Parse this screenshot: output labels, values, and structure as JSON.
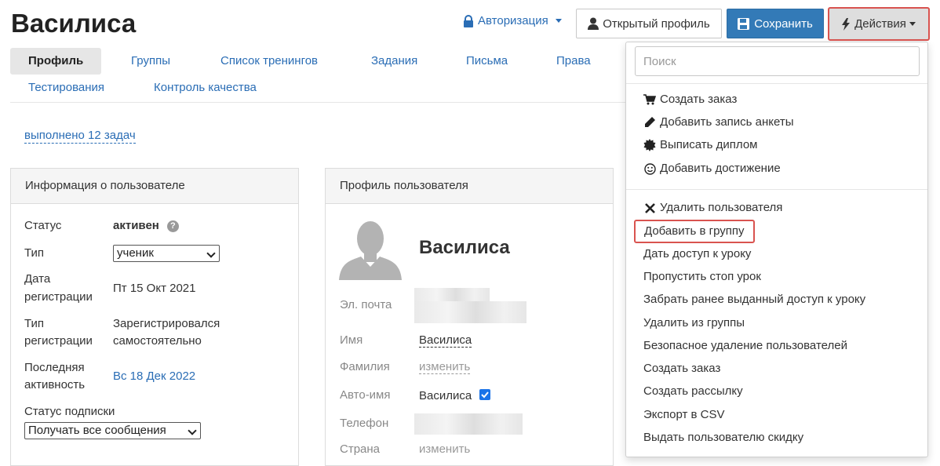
{
  "header": {
    "title": "Василиса",
    "auth_label": "Авторизация",
    "open_profile_label": "Открытый профиль",
    "save_label": "Сохранить",
    "actions_label": "Действия"
  },
  "tabs": [
    "Профиль",
    "Группы",
    "Список тренингов",
    "Задания",
    "Письма",
    "Права",
    "Тестирования",
    "Контроль качества"
  ],
  "tasks_link": "выполнено 12 задач",
  "user_info": {
    "heading": "Информация о пользователе",
    "status_label": "Статус",
    "status_value": "активен",
    "type_label": "Тип",
    "type_value": "ученик",
    "reg_date_label_1": "Дата",
    "reg_date_label_2": "регистрации",
    "reg_date_value": "Пт 15 Окт 2021",
    "reg_type_label_1": "Тип",
    "reg_type_label_2": "регистрации",
    "reg_type_value_1": "Зарегистрировался",
    "reg_type_value_2": "самостоятельно",
    "last_activity_label_1": "Последняя",
    "last_activity_label_2": "активность",
    "last_activity_value": "Вс 18 Дек 2022",
    "subscription_label": "Статус подписки",
    "subscription_value": "Получать все сообщения"
  },
  "profile": {
    "heading": "Профиль пользователя",
    "name_big": "Василиса",
    "email_label": "Эл. почта",
    "first_name_label": "Имя",
    "first_name_value": "Василиса",
    "last_name_label": "Фамилия",
    "last_name_value": "изменить",
    "auto_name_label": "Авто-имя",
    "auto_name_value": "Василиса",
    "phone_label": "Телефон",
    "country_label": "Страна",
    "country_value": "изменить"
  },
  "actions_menu": {
    "search_placeholder": "Поиск",
    "group1": [
      {
        "label": "Создать заказ",
        "icon": "cart-icon"
      },
      {
        "label": "Добавить запись анкеты",
        "icon": "pencil-icon"
      },
      {
        "label": "Выписать диплом",
        "icon": "certificate-icon"
      },
      {
        "label": "Добавить достижение",
        "icon": "smile-icon"
      }
    ],
    "delete_user": "Удалить пользователя",
    "items": [
      "Добавить в группу",
      "Дать доступ к уроку",
      "Пропустить стоп урок",
      "Забрать ранее выданный доступ к уроку",
      "Удалить из группы",
      "Безопасное удаление пользователей",
      "Создать заказ",
      "Создать рассылку",
      "Экспорт в CSV",
      "Выдать пользователю скидку"
    ]
  },
  "colors": {
    "link": "#2a6db5",
    "primary_button": "#337ab7",
    "highlight_border": "#d9534f"
  }
}
